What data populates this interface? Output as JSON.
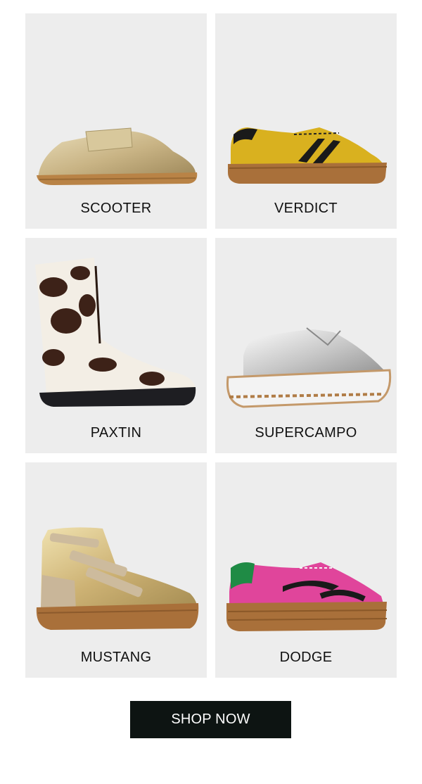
{
  "products": [
    {
      "name": "SCOOTER",
      "icon": "gold-ballet-sneaker-image"
    },
    {
      "name": "VERDICT",
      "icon": "yellow-suede-sneaker-image"
    },
    {
      "name": "PAXTIN",
      "icon": "cow-print-high-top-boot-image"
    },
    {
      "name": "SUPERCAMPO",
      "icon": "silver-platform-sneaker-image"
    },
    {
      "name": "MUSTANG",
      "icon": "gold-high-top-velcro-sneaker-image"
    },
    {
      "name": "DODGE",
      "icon": "pink-suede-sneaker-image"
    }
  ],
  "cta": {
    "label": "SHOP NOW"
  },
  "colors": {
    "card_bg": "#ededed",
    "button_bg": "#0d1412",
    "button_text": "#ffffff",
    "label_text": "#111111"
  }
}
